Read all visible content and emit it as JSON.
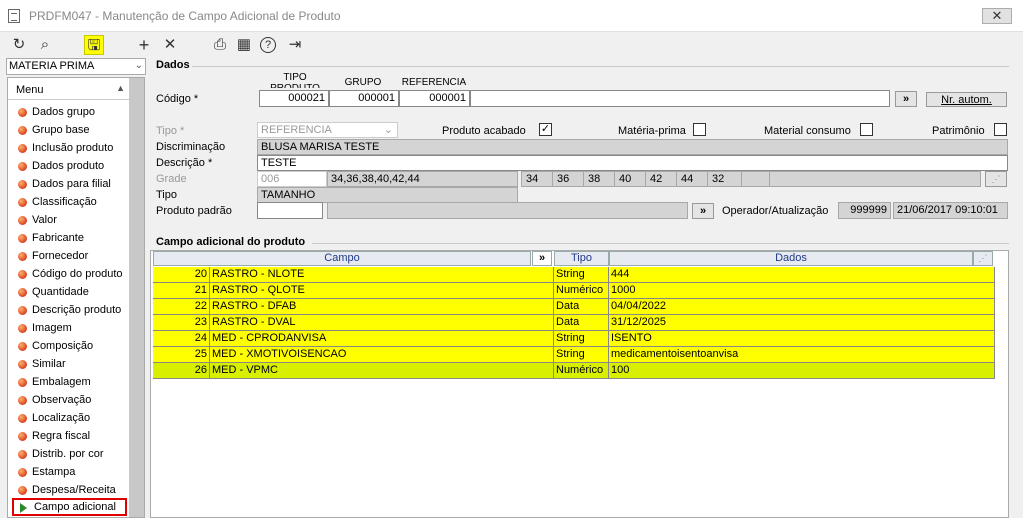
{
  "window": {
    "title": "PRDFM047 - Manutenção de Campo Adicional de Produto",
    "close": "✕"
  },
  "toolbar": {
    "refresh": "↻",
    "search": "⌕",
    "save": "🖫",
    "add": "+",
    "delete": "✕",
    "print": "⎙",
    "calendar": "▦",
    "help": "?",
    "exit": "⇥"
  },
  "sidebar": {
    "combo": "MATERIA PRIMA",
    "header": "Menu",
    "items": [
      "Dados grupo",
      "Grupo base",
      "Inclusão produto",
      "Dados produto",
      "Dados para filial",
      "Classificação",
      "Valor",
      "Fabricante",
      "Fornecedor",
      "Código do produto",
      "Quantidade",
      "Descrição produto",
      "Imagem",
      "Composição",
      "Similar",
      "Embalagem",
      "Observação",
      "Localização",
      "Regra fiscal",
      "Distrib. por cor",
      "Estampa",
      "Despesa/Receita"
    ],
    "selected": "Campo adicional"
  },
  "dados": {
    "section": "Dados",
    "codigo_label": "Código *",
    "col_tipo": "TIPO PRODUTO",
    "col_grupo": "GRUPO",
    "col_ref": "REFERENCIA",
    "tipo_produto": "000021",
    "grupo": "000001",
    "referencia": "000001",
    "codigo_desc": "",
    "nav": "»",
    "nr_autom": "Nr. autom.",
    "tipo_label": "Tipo *",
    "tipo_value": "REFERENCIA",
    "produto_acabado_label": "Produto acabado",
    "produto_acabado_checked": "✓",
    "materia_prima_label": "Matéria-prima",
    "material_consumo_label": "Material consumo",
    "patrimonio_label": "Patrimônio",
    "discriminacao_label": "Discriminação",
    "discriminacao": "BLUSA MARISA TESTE",
    "descricao_label": "Descrição *",
    "descricao": "TESTE",
    "grade_label": "Grade",
    "grade_code": "006",
    "grade_sizes": "34,36,38,40,42,44",
    "sizes": [
      "34",
      "36",
      "38",
      "40",
      "42",
      "44",
      "32"
    ],
    "tipo2_label": "Tipo",
    "tipo2_value": "TAMANHO",
    "produto_padrao_label": "Produto padrão",
    "produto_padrao": "",
    "operador_label": "Operador/Atualização",
    "operador": "999999",
    "atualizacao": "21/06/2017 09:10:01"
  },
  "campo_adicional": {
    "section": "Campo adicional do produto",
    "headers": {
      "campo": "Campo",
      "nav": "»",
      "tipo": "Tipo",
      "dados": "Dados"
    },
    "rows": [
      {
        "num": "20",
        "campo": "RASTRO - NLOTE",
        "tipo": "String",
        "dados": "444"
      },
      {
        "num": "21",
        "campo": "RASTRO - QLOTE",
        "tipo": "Numérico",
        "dados": "1000"
      },
      {
        "num": "22",
        "campo": "RASTRO - DFAB",
        "tipo": "Data",
        "dados": "04/04/2022"
      },
      {
        "num": "23",
        "campo": "RASTRO - DVAL",
        "tipo": "Data",
        "dados": "31/12/2025"
      },
      {
        "num": "24",
        "campo": "MED - CPRODANVISA",
        "tipo": "String",
        "dados": "ISENTO"
      },
      {
        "num": "25",
        "campo": "MED - XMOTIVOISENCAO",
        "tipo": "String",
        "dados": "medicamentoisentoanvisa"
      },
      {
        "num": "26",
        "campo": "MED - VPMC",
        "tipo": "Numérico",
        "dados": "100"
      }
    ],
    "row_color": "#ffff00",
    "selected_row_color": "#d8f000"
  }
}
